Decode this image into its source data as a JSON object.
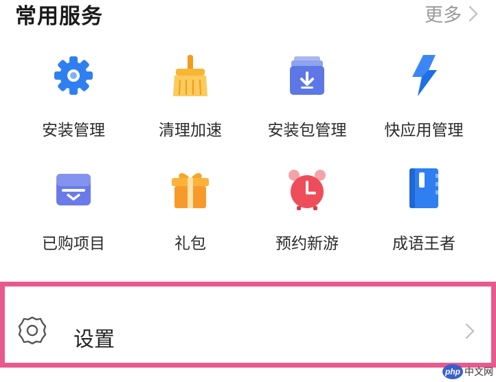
{
  "header": {
    "title": "常用服务",
    "more_label": "更多"
  },
  "services": [
    {
      "label": "安装管理",
      "icon": "gear-icon"
    },
    {
      "label": "清理加速",
      "icon": "broom-icon"
    },
    {
      "label": "安装包管理",
      "icon": "package-download-icon"
    },
    {
      "label": "快应用管理",
      "icon": "lightning-icon"
    },
    {
      "label": "已购项目",
      "icon": "purchased-box-icon"
    },
    {
      "label": "礼包",
      "icon": "gift-icon"
    },
    {
      "label": "预约新游",
      "icon": "alarm-clock-icon"
    },
    {
      "label": "成语王者",
      "icon": "book-icon"
    }
  ],
  "settings": {
    "label": "设置",
    "icon": "settings-gear-icon"
  },
  "watermark": {
    "badge": "php",
    "text": "中文网"
  },
  "colors": {
    "highlight_border": "#e9598d",
    "accent_blue": "#3b7cf0",
    "accent_orange": "#f5a623"
  }
}
